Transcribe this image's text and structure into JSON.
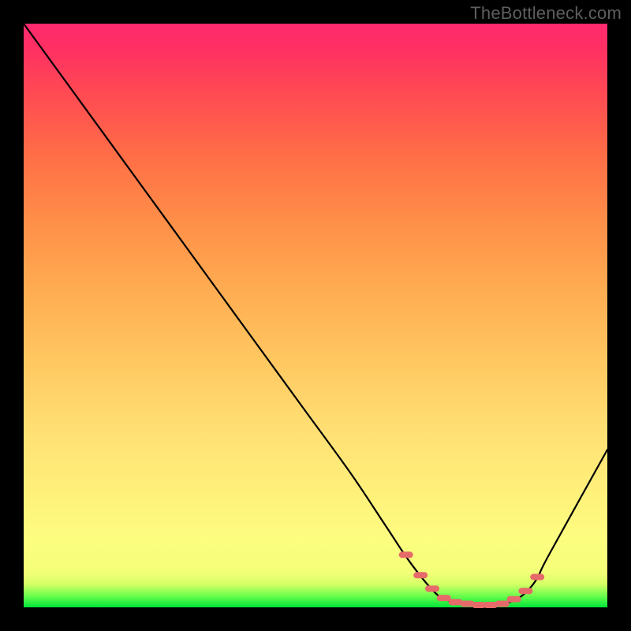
{
  "watermark": "TheBottleneck.com",
  "chart_data": {
    "type": "line",
    "title": "",
    "xlabel": "",
    "ylabel": "",
    "xlim": [
      0,
      100
    ],
    "ylim": [
      0,
      100
    ],
    "gradient_meaning": "background hue indicates bottleneck severity from green (good, low) to red (bad, high)",
    "series": [
      {
        "name": "bottleneck-curve",
        "x": [
          0,
          8,
          16,
          24,
          32,
          40,
          48,
          56,
          62,
          66,
          70,
          72,
          74,
          76,
          78,
          80,
          82,
          84,
          86,
          88,
          90,
          100
        ],
        "values": [
          100,
          89,
          78,
          67,
          56,
          45,
          34,
          23,
          14,
          8,
          3,
          1.5,
          0.8,
          0.5,
          0.3,
          0.3,
          0.5,
          1.2,
          2.5,
          5,
          9,
          27
        ]
      }
    ],
    "optimal_markers": {
      "comment": "dashed salmon markers near curve minimum",
      "x": [
        65.5,
        68.0,
        70.0,
        72.0,
        74.0,
        76.0,
        78.0,
        80.0,
        82.0,
        84.0,
        86.0,
        88.0
      ],
      "values": [
        9.0,
        5.5,
        3.2,
        1.6,
        0.9,
        0.6,
        0.4,
        0.4,
        0.6,
        1.4,
        2.8,
        5.2
      ]
    },
    "colors": {
      "curve": "#000000",
      "markers": "#e76a6a",
      "gradient_top": "#ff2a6e",
      "gradient_bottom": "#00e53a"
    }
  }
}
